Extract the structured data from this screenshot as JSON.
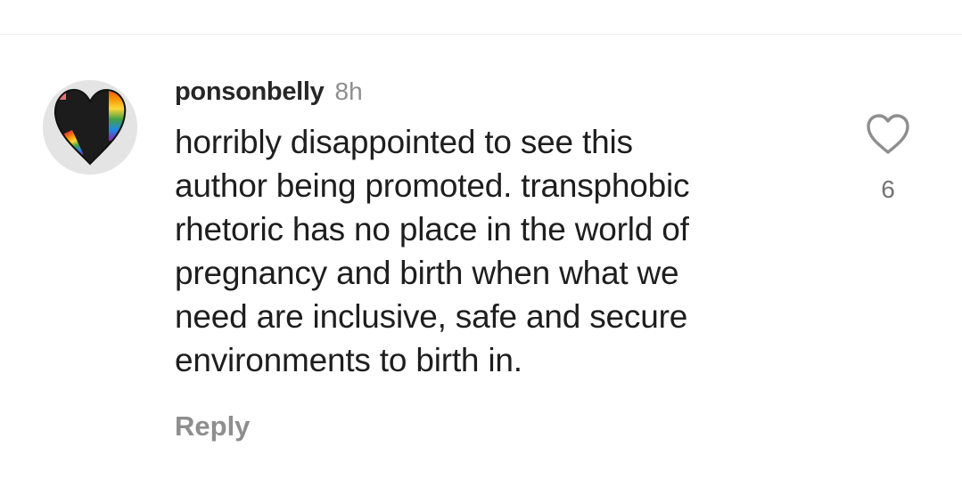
{
  "comment": {
    "username": "ponsonbelly",
    "time": "8h",
    "text_lines": [
      "horribly disappointed to see this",
      "author being promoted. transphobic",
      "rhetoric has no place in the world of",
      "pregnancy and birth when what we",
      "need are inclusive, safe and secure",
      "environments to birth in."
    ],
    "reply_label": "Reply",
    "like_count": "6",
    "avatar_icon": "rainbow-heart-avatar",
    "like_icon": "heart-outline-icon"
  },
  "colors": {
    "username": "#262626",
    "meta": "#8e8e8e",
    "like_icon": "#8e8e8e"
  }
}
